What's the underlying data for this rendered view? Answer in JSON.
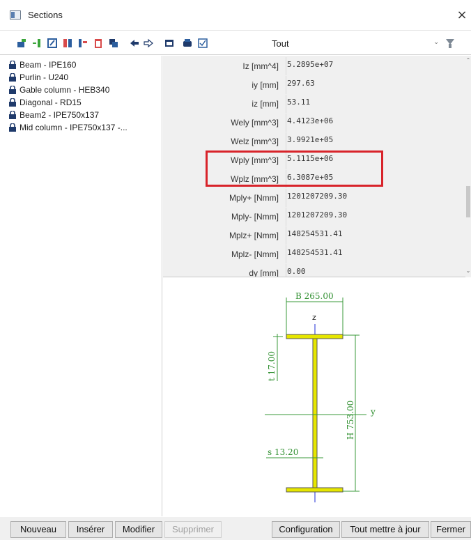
{
  "window": {
    "title": "Sections",
    "close_glyph": "×"
  },
  "toolbar": {
    "filter_value": "Tout",
    "icons": [
      "new-section-icon",
      "insert-icon",
      "edit-icon",
      "properties-icon",
      "split-icon",
      "delete-icon",
      "copy-icon",
      "undo-icon",
      "redo-icon",
      "table-icon",
      "print-icon",
      "check-icon"
    ],
    "dropdown_glyph": "⌄",
    "colors": {
      "green": "#3aa53a",
      "red": "#d84a4a",
      "blue": "#2c5e9e",
      "navy": "#1f3a6b"
    }
  },
  "sections": [
    {
      "label": "Beam - IPE160"
    },
    {
      "label": "Purlin - U240"
    },
    {
      "label": "Gable column - HEB340"
    },
    {
      "label": "Diagonal - RD15"
    },
    {
      "label": "Beam2 - IPE750x137"
    },
    {
      "label": "Mid column - IPE750x137 -..."
    }
  ],
  "properties": [
    {
      "name": "Iz [mm^4]",
      "value": "5.2895e+07"
    },
    {
      "name": "iy [mm]",
      "value": "297.63"
    },
    {
      "name": "iz [mm]",
      "value": "53.11"
    },
    {
      "name": "Wely [mm^3]",
      "value": "4.4123e+06"
    },
    {
      "name": "Welz [mm^3]",
      "value": "3.9921e+05"
    },
    {
      "name": "Wply [mm^3]",
      "value": "5.1115e+06"
    },
    {
      "name": "Wplz [mm^3]",
      "value": "6.3087e+05"
    },
    {
      "name": "Mply+ [Nmm]",
      "value": "1201207209.30"
    },
    {
      "name": "Mply- [Nmm]",
      "value": "1201207209.30"
    },
    {
      "name": "Mplz+ [Nmm]",
      "value": "148254531.41"
    },
    {
      "name": "Mplz- [Nmm]",
      "value": "148254531.41"
    },
    {
      "name": "dy [mm]",
      "value": "0.00"
    }
  ],
  "drawing": {
    "width_label": "B 265.00",
    "height_label": "H 753.00",
    "flange_label": "t 17.00",
    "web_label": "s 13.20",
    "axis_z": "z",
    "axis_y": "y",
    "colors": {
      "flange_fill": "#e6e600",
      "dim_line": "#3a9a3a",
      "axis": "#1c2bd4",
      "text": "#2f8f2f"
    }
  },
  "buttons": {
    "nouveau": "Nouveau",
    "inserer": "Insérer",
    "modifier": "Modifier",
    "supprimer": "Supprimer",
    "configuration": "Configuration",
    "mettre_a_jour": "Tout mettre à jour",
    "fermer": "Fermer"
  },
  "highlight_color": "#d8232a"
}
